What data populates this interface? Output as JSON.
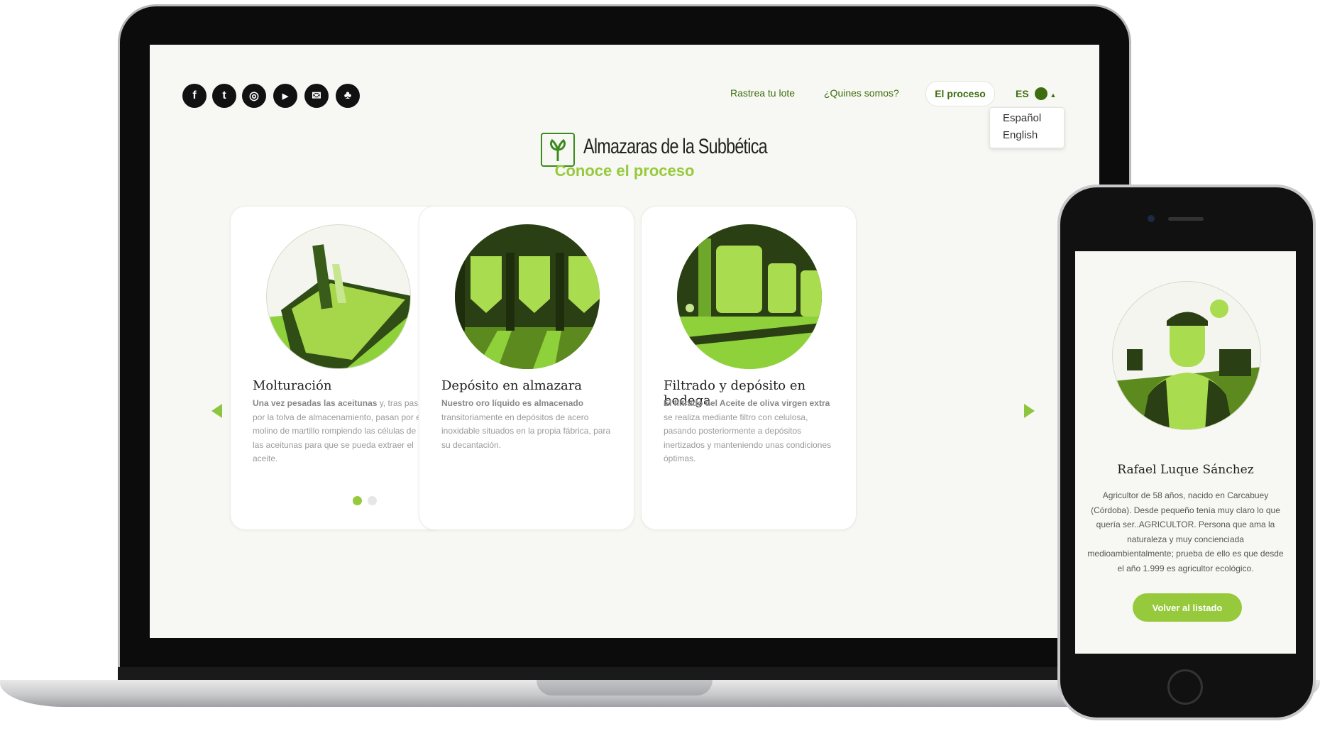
{
  "social": [
    {
      "icon": "facebook-icon",
      "glyph": "f"
    },
    {
      "icon": "twitter-icon",
      "glyph": "t"
    },
    {
      "icon": "instagram-icon",
      "glyph": "◎"
    },
    {
      "icon": "youtube-icon",
      "glyph": "▶"
    },
    {
      "icon": "email-icon",
      "glyph": "✉"
    },
    {
      "icon": "tree-icon",
      "glyph": "♣"
    }
  ],
  "nav": {
    "trace": "Rastrea tu lote",
    "about": "¿Quines somos?",
    "process": "El proceso",
    "lang": "ES",
    "lang_options": [
      "Español",
      "English"
    ]
  },
  "logo": {
    "text": "Almazaras de la Subbética"
  },
  "section_title": "Conoce el proceso",
  "cards": [
    {
      "title": "Molturación",
      "bold": "Una vez pesadas las aceitunas",
      "text": " y, tras pasar por la tolva de almacenamiento, pasan por el molino de martillo rompiendo las células de las aceitunas para que se pueda extraer el aceite."
    },
    {
      "title": "Depósito en almazara",
      "bold": "Nuestro oro líquido es almacenado",
      "text": " transitoriamente en depósitos de acero inoxidable situados en la propia fábrica, para su decantación."
    },
    {
      "title": "Filtrado y depósito en bodega",
      "bold": "El filtrado del Aceite de oliva virgen extra",
      "text": " se realiza mediante filtro con celulosa, pasando posteriormente a depósitos inertizados y manteniendo unas condiciones óptimas."
    }
  ],
  "carousel": {
    "active_page": 1,
    "pages": 2
  },
  "phone": {
    "name": "Rafael Luque Sánchez",
    "bio": "Agricultor de 58 años, nacido en Carcabuey (Córdoba). Desde pequeño tenía muy claro lo que quería ser..AGRICULTOR. Persona que ama la naturaleza y muy concienciada medioambientalmente; prueba de ello es que desde el año 1.999 es agricultor ecológico.",
    "button": "Volver al listado"
  },
  "colors": {
    "accent": "#97c93d",
    "dark_green": "#2d4a14",
    "nav_green": "#3d6e0e"
  }
}
